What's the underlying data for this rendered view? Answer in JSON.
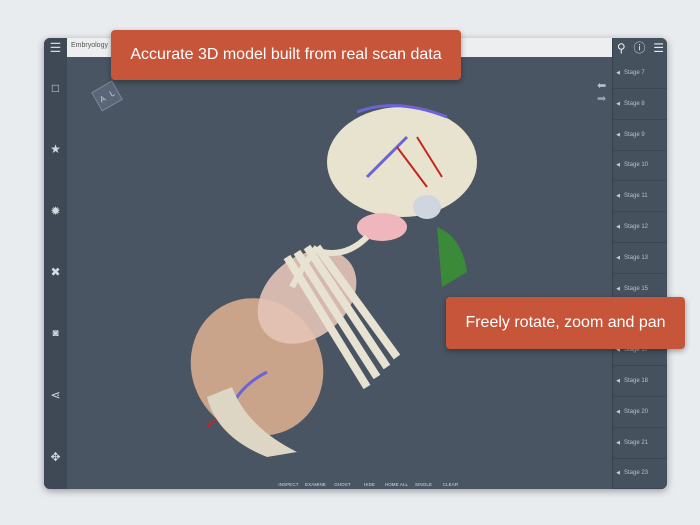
{
  "callouts": {
    "top": "Accurate 3D model built from real scan data",
    "right": "Freely rotate, zoom and pan"
  },
  "topbar": {
    "tab": "Embryology"
  },
  "orientation_cube": {
    "a": "A",
    "l": "L"
  },
  "stages": [
    "Stage 7",
    "Stage 8",
    "Stage 9",
    "Stage 10",
    "Stage 11",
    "Stage 12",
    "Stage 13",
    "Stage 15",
    "",
    "Stage 17",
    "Stage 18",
    "Stage 20",
    "Stage 21",
    "Stage 23"
  ],
  "tools": [
    {
      "label": "INSPECT",
      "icon": "⛶"
    },
    {
      "label": "EXAMINE",
      "icon": "⁘"
    },
    {
      "label": "GHOST",
      "icon": "○"
    },
    {
      "label": "HIDE",
      "icon": "⊖"
    },
    {
      "label": "HOME ALL",
      "icon": "⊞"
    },
    {
      "label": "SINGLE",
      "icon": "➘"
    },
    {
      "label": "CLEAR",
      "icon": "✕"
    }
  ],
  "colors": {
    "accent": "#c6553a",
    "canvas": "#4a5563",
    "sidebar": "#3f4956"
  }
}
